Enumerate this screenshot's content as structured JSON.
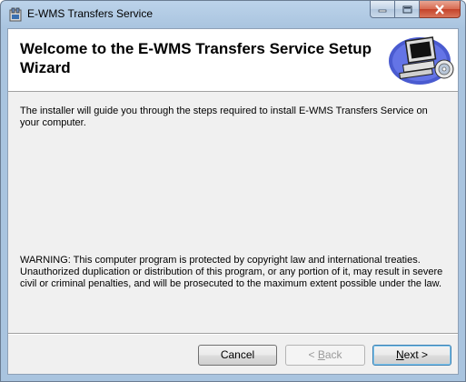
{
  "window": {
    "title": "E-WMS Transfers Service"
  },
  "banner": {
    "heading": "Welcome to the E-WMS Transfers Service Setup Wizard",
    "image_icon": "computer-setup-icon"
  },
  "content": {
    "intro": "The installer will guide you through the steps required to install E-WMS Transfers Service on your computer.",
    "warning": "WARNING: This computer program is protected by copyright law and international treaties. Unauthorized duplication or distribution of this program, or any portion of it, may result in severe civil or criminal penalties, and will be prosecuted to the maximum extent possible under the law."
  },
  "buttons": {
    "cancel": "Cancel",
    "back_prefix": "< ",
    "back_mnemonic": "B",
    "back_rest": "ack",
    "next_prefix": "",
    "next_mnemonic": "N",
    "next_rest": "ext >"
  }
}
